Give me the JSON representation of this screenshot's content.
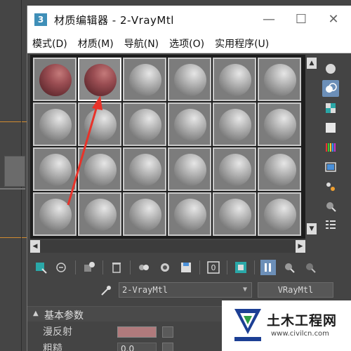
{
  "window": {
    "app_icon_label": "3",
    "title": "材质编辑器 - 2-VrayMtl",
    "minimize_glyph": "—",
    "maximize_glyph": "☐",
    "close_glyph": "✕"
  },
  "menu": {
    "items": [
      {
        "label": "模式(D)"
      },
      {
        "label": "材质(M)"
      },
      {
        "label": "导航(N)"
      },
      {
        "label": "选项(O)"
      },
      {
        "label": "实用程序(U)"
      }
    ]
  },
  "sample_slots": {
    "rows": 4,
    "columns": 6,
    "active_slot": 2,
    "colored_slots": [
      1,
      2
    ],
    "material_color": "#9b4e53",
    "default_color": "#9a9a9a"
  },
  "right_toolbar": {
    "icons": [
      "sample-type-sphere-icon",
      "backlight-icon",
      "background-checker-icon",
      "sample-uv-tiling-icon",
      "video-color-check-icon",
      "make-preview-icon",
      "options-icon",
      "select-by-material-icon",
      "material-map-navigator-icon"
    ],
    "selected": "backlight-icon"
  },
  "bottom_toolbar": {
    "icons": [
      "get-material-icon",
      "put-to-scene-icon",
      "assign-to-selection-icon",
      "reset-map-icon",
      "make-unique-icon",
      "put-to-library-icon",
      "save-material-icon",
      "material-id-channel-icon",
      "show-shaded-icon",
      "show-end-result-icon",
      "go-to-parent-icon",
      "go-forward-icon"
    ],
    "material_id": "0",
    "selected": "show-end-result-icon"
  },
  "material": {
    "name": "2-VrayMtl",
    "type": "VRayMtl"
  },
  "params": {
    "section_title": "基本参数",
    "toggle_glyph": "▲",
    "diffuse_label": "漫反射",
    "diffuse_color": "#b07a7c",
    "roughness_label": "粗糙",
    "roughness_value": "0.0"
  },
  "watermark": {
    "title": "土木工程网",
    "url": "www.civilcn.com"
  },
  "annotation": {
    "arrow_color": "#e8332a"
  }
}
